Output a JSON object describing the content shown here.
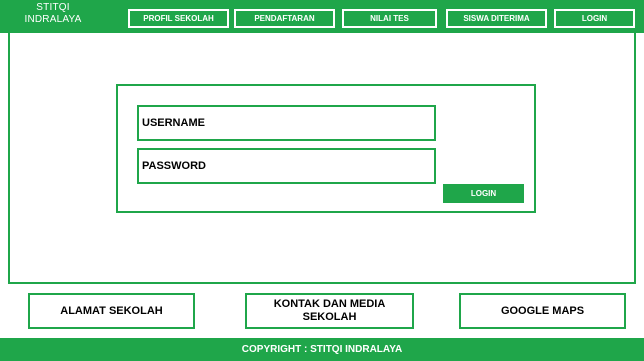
{
  "header": {
    "brand": "STITQI INDRALAYA",
    "nav": [
      {
        "label": "PROFIL SEKOLAH"
      },
      {
        "label": "PENDAFTARAN"
      },
      {
        "label": "NILAI TES"
      },
      {
        "label": "SISWA DITERIMA"
      },
      {
        "label": "LOGIN"
      }
    ]
  },
  "login_form": {
    "username_label": "USERNAME",
    "password_label": "PASSWORD",
    "submit_label": "LOGIN"
  },
  "footer": {
    "links": [
      {
        "label": "ALAMAT SEKOLAH"
      },
      {
        "label": "KONTAK DAN MEDIA SEKOLAH"
      },
      {
        "label": "GOOGLE MAPS"
      }
    ],
    "copyright": "COPYRIGHT : STITQI INDRALAYA"
  },
  "colors": {
    "accent": "#1fa64a",
    "text_on_accent": "#ffffff"
  }
}
